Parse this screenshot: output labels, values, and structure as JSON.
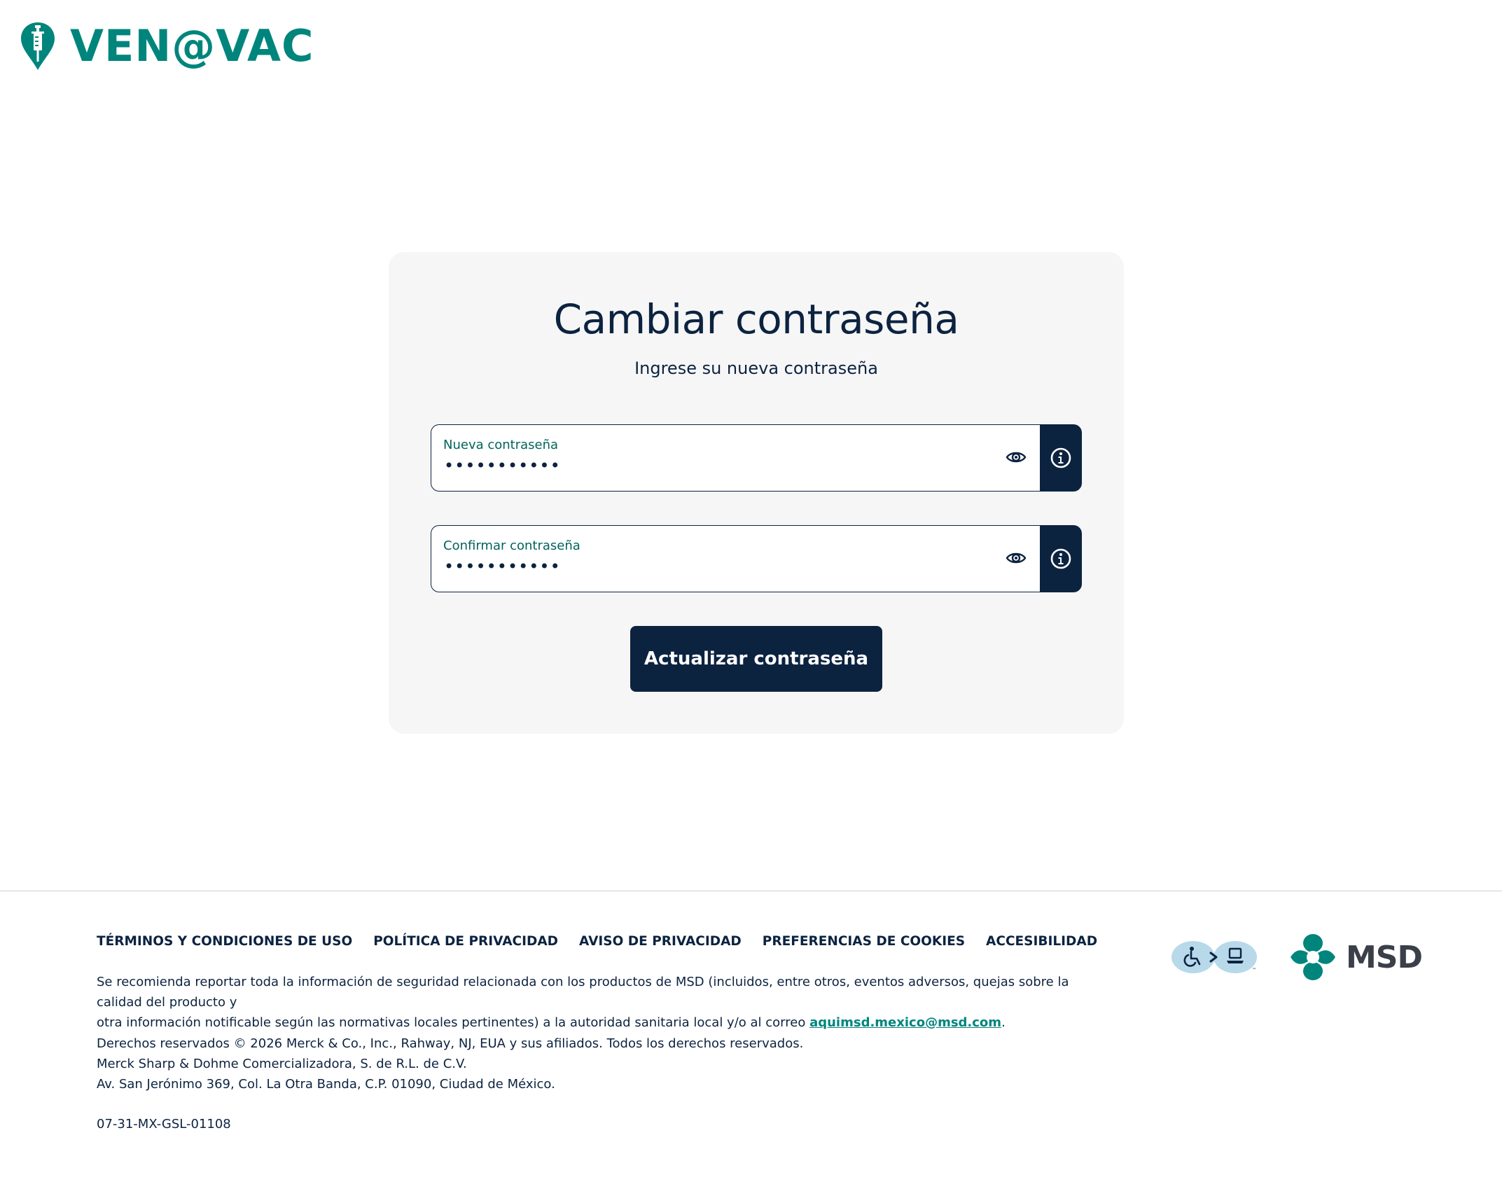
{
  "brand": {
    "name": "VEN@VAC",
    "color": "#00857c",
    "icon": "syringe-pin-icon"
  },
  "card": {
    "title": "Cambiar contraseña",
    "subtitle": "Ingrese su nueva contraseña",
    "fields": [
      {
        "label": "Nueva contraseña",
        "value": "•••••••••••",
        "toggle_icon": "eye-icon",
        "info_icon": "info-icon"
      },
      {
        "label": "Confirmar contraseña",
        "value": "•••••••••••",
        "toggle_icon": "eye-icon",
        "info_icon": "info-icon"
      }
    ],
    "submit_label": "Actualizar contraseña",
    "primary_color": "#0c2340"
  },
  "footer": {
    "links": [
      "TÉRMINOS Y CONDICIONES DE USO",
      "POLÍTICA DE PRIVACIDAD",
      "AVISO DE PRIVACIDAD",
      "PREFERENCIAS DE COOKIES",
      "ACCESIBILIDAD"
    ],
    "report_line_1": "Se recomienda reportar toda la información de seguridad relacionada con los productos de MSD (incluidos, entre otros, eventos adversos, quejas sobre la calidad del producto y",
    "report_line_2": "otra información notificable según las normativas locales pertinentes) a la autoridad sanitaria local y/o al correo",
    "report_email": "aquimsd.mexico@msd.com",
    "report_end": ".",
    "rights_line_1": "Derechos reservados © 2026 Merck & Co., Inc., Rahway, NJ, EUA y sus afiliados. Todos los derechos reservados.",
    "rights_line_2": "Merck Sharp & Dohme Comercializadora, S. de R.L. de C.V.",
    "rights_line_3": "Av. San Jerónimo 369, Col. La Otra Banda, C.P. 01090, Ciudad de México.",
    "code": "07-31-MX-GSL-01108",
    "accessibility_badge_icon": "accessibility-badge-icon",
    "msd_brand": "MSD",
    "msd_icon": "msd-logo-icon"
  }
}
